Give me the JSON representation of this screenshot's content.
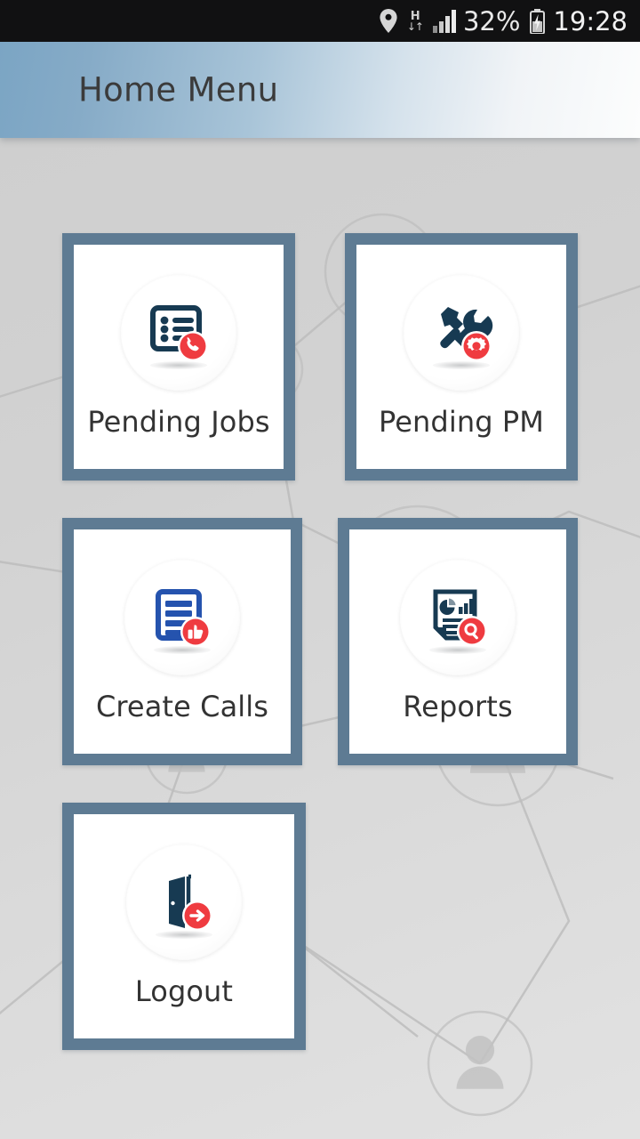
{
  "statusbar": {
    "location_icon": "location-pin-icon",
    "network_type": "H",
    "network_arrows": "data-transfer-arrows-icon",
    "signal_icon": "signal-bars-icon",
    "battery_percent": "32%",
    "battery_icon": "battery-charging-icon",
    "time": "19:28"
  },
  "header": {
    "title": "Home Menu"
  },
  "menu": {
    "tiles": [
      {
        "label": "Pending Jobs",
        "icon": "list-document-phone-icon",
        "badge_color": "#ef3b40",
        "icon_color": "#173a52"
      },
      {
        "label": "Pending PM",
        "icon": "hammer-wrench-gear-icon",
        "badge_color": "#ef3b40",
        "icon_color": "#173a52"
      },
      {
        "label": "Create Calls",
        "icon": "document-thumbs-up-icon",
        "badge_color": "#ef3b40",
        "icon_color": "#2553ae"
      },
      {
        "label": "Reports",
        "icon": "chart-document-search-icon",
        "badge_color": "#ef3b40",
        "icon_color": "#173a52"
      },
      {
        "label": "Logout",
        "icon": "door-exit-arrow-icon",
        "badge_color": "#ef3b40",
        "icon_color": "#173a52"
      }
    ]
  },
  "theme": {
    "tile_border": "#5e7b93",
    "tile_face": "#ffffff",
    "label_color": "#333333",
    "accent_red": "#ef3b40",
    "navy": "#173a52",
    "blue": "#2553ae",
    "header_gradient_start": "#7ba5c4",
    "header_gradient_end": "#fcfdfd",
    "background": "#d6d6d6",
    "statusbar_bg": "#111112"
  }
}
